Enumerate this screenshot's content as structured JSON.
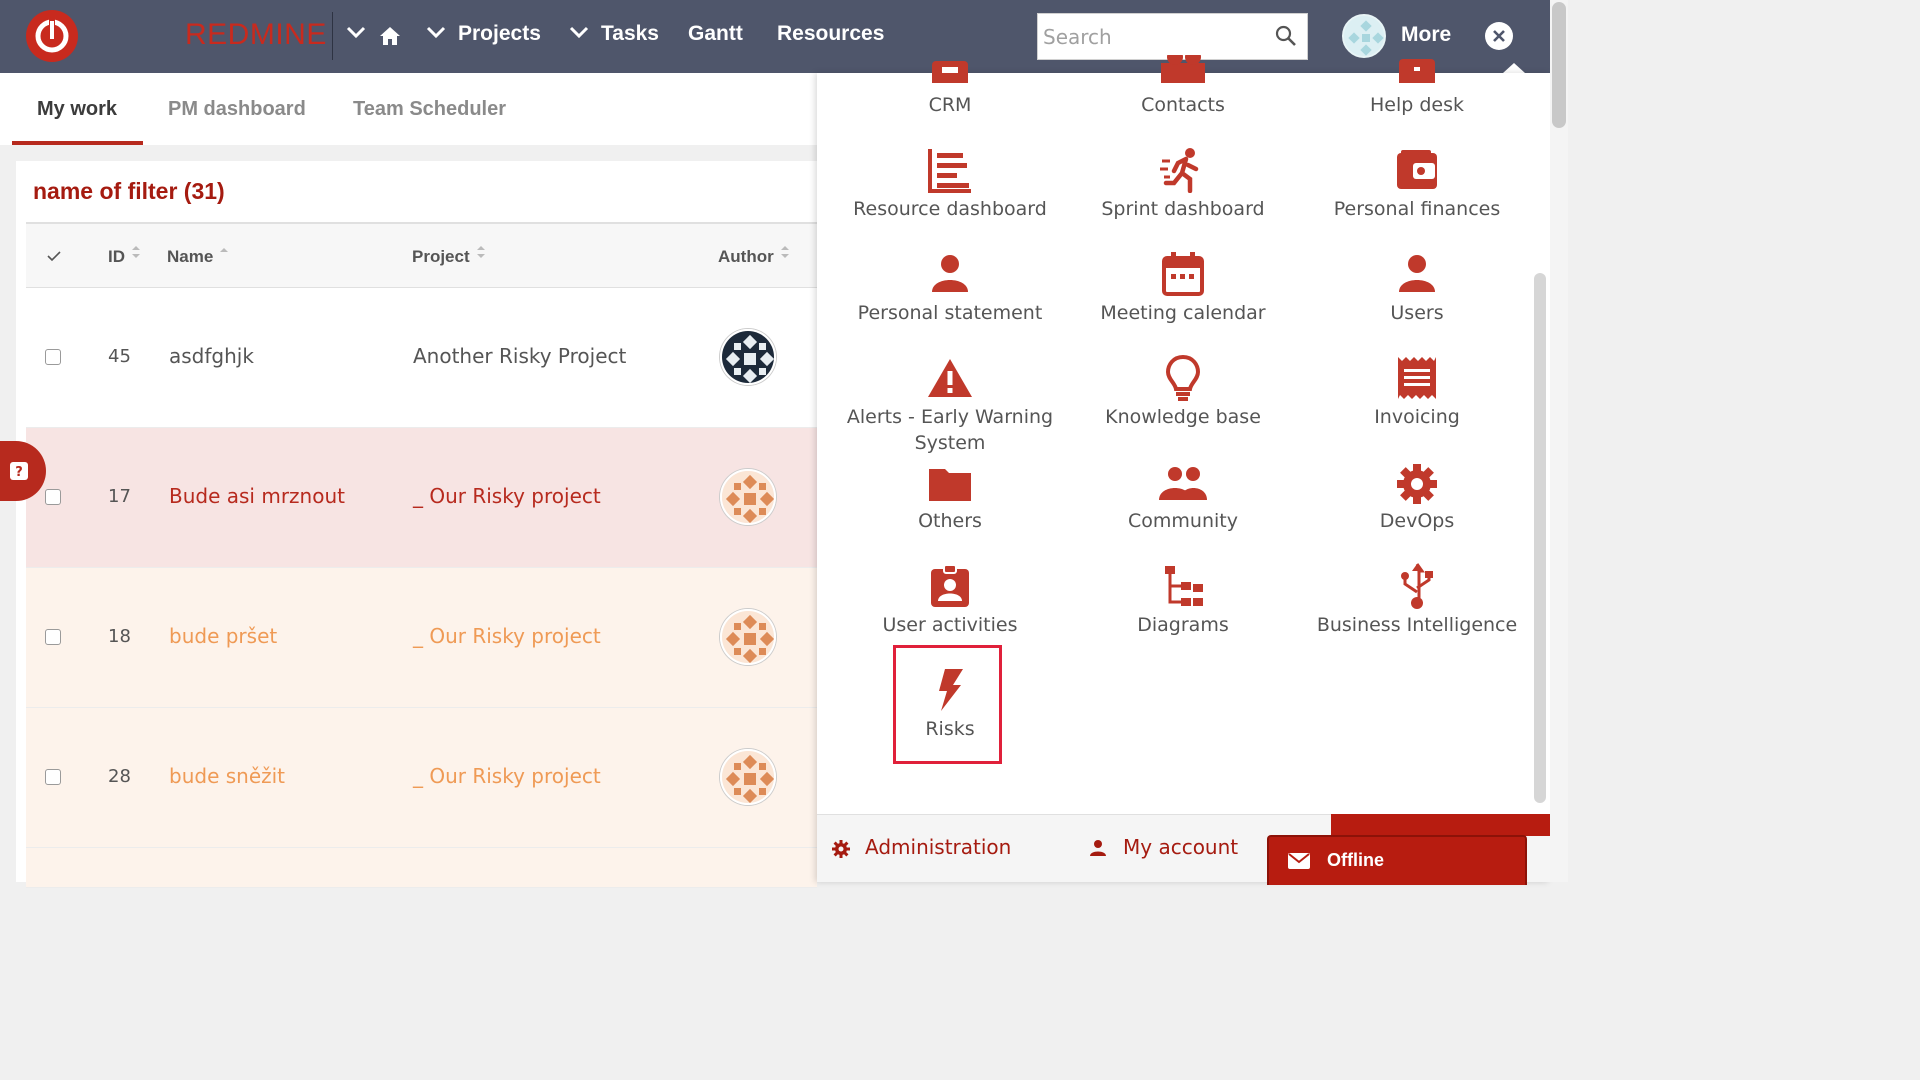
{
  "app": {
    "logo_text": "REDMINE",
    "nav": {
      "projects": "Projects",
      "tasks": "Tasks",
      "gantt": "Gantt",
      "resources": "Resources"
    },
    "search": {
      "placeholder": "Search"
    },
    "more_label": "More"
  },
  "tabs": [
    {
      "label": "My work",
      "active": true
    },
    {
      "label": "PM dashboard",
      "active": false
    },
    {
      "label": "Team Scheduler",
      "active": false
    }
  ],
  "filter": {
    "title": "name of filter (31)",
    "columns": {
      "id": "ID",
      "name": "Name",
      "project": "Project",
      "author": "Author"
    },
    "rows": [
      {
        "id": "45",
        "name": "asdfghjk",
        "project": "Another Risky Project",
        "color": "#555555",
        "bg": "#ffffff",
        "avatar": "dark"
      },
      {
        "id": "17",
        "name": "Bude asi mrznout",
        "project": "_ Our Risky project",
        "color": "#b72a1e",
        "bg": "#f7e4e3",
        "avatar": "orange"
      },
      {
        "id": "18",
        "name": "bude pršet",
        "project": "_ Our Risky project",
        "color": "#ef9a55",
        "bg": "#fdf3eb",
        "avatar": "orange"
      },
      {
        "id": "28",
        "name": "bude sněžit",
        "project": "_ Our Risky project",
        "color": "#ef9a55",
        "bg": "#fdf3eb",
        "avatar": "orange"
      }
    ]
  },
  "menu": {
    "items": [
      {
        "label": "CRM",
        "icon": "crm-icon"
      },
      {
        "label": "Contacts",
        "icon": "contacts-icon"
      },
      {
        "label": "Help desk",
        "icon": "help-desk-icon"
      },
      {
        "label": "Resource dashboard",
        "icon": "resource-dashboard-icon"
      },
      {
        "label": "Sprint dashboard",
        "icon": "running-person-icon"
      },
      {
        "label": "Personal finances",
        "icon": "wallet-icon"
      },
      {
        "label": "Personal statement",
        "icon": "person-icon"
      },
      {
        "label": "Meeting calendar",
        "icon": "calendar-icon"
      },
      {
        "label": "Users",
        "icon": "user-icon"
      },
      {
        "label": "Alerts - Early Warning System",
        "icon": "warning-icon"
      },
      {
        "label": "Knowledge base",
        "icon": "lightbulb-icon"
      },
      {
        "label": "Invoicing",
        "icon": "receipt-icon"
      },
      {
        "label": "Others",
        "icon": "folder-icon"
      },
      {
        "label": "Community",
        "icon": "group-icon"
      },
      {
        "label": "DevOps",
        "icon": "gear-icon"
      },
      {
        "label": "User activities",
        "icon": "id-badge-icon"
      },
      {
        "label": "Diagrams",
        "icon": "diagram-icon"
      },
      {
        "label": "Business Intelligence",
        "icon": "usb-icon"
      },
      {
        "label": "Risks",
        "icon": "lightning-icon"
      }
    ],
    "footer": {
      "administration": "Administration",
      "my_account": "My account",
      "offline": "Offline"
    }
  },
  "colors": {
    "accent": "#b72a1e",
    "topbar": "#4f566b",
    "highlight_border": "#e0203a"
  }
}
